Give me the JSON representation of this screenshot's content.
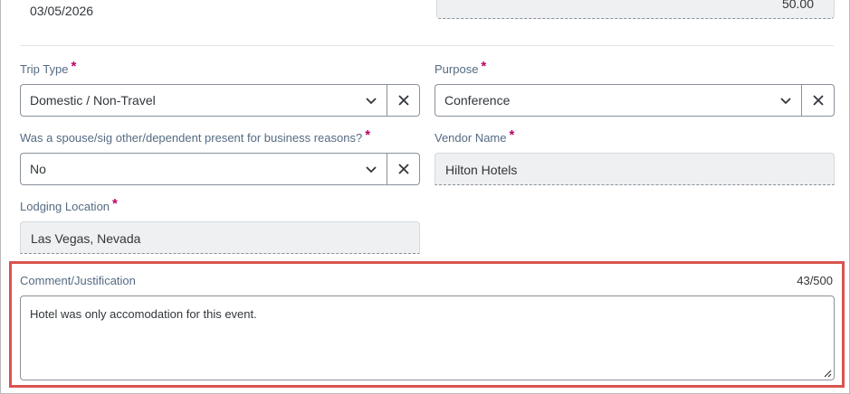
{
  "top": {
    "date_value": "03/05/2026",
    "amount_value": "50.00"
  },
  "trip_type": {
    "label": "Trip Type",
    "value": "Domestic / Non-Travel"
  },
  "purpose": {
    "label": "Purpose",
    "value": "Conference"
  },
  "spouse_present": {
    "label": "Was a spouse/sig other/dependent present for business reasons?",
    "value": "No"
  },
  "vendor_name": {
    "label": "Vendor Name",
    "value": "Hilton Hotels"
  },
  "lodging_location": {
    "label": "Lodging Location",
    "value": "Las Vegas, Nevada"
  },
  "comment": {
    "label": "Comment/Justification",
    "counter": "43/500",
    "value": "Hotel was only accomodation for this event."
  },
  "required_marker": "*",
  "colors": {
    "required": "#bb0066",
    "highlight": "#d9534f",
    "label": "#556b82"
  },
  "icons": {
    "dropdown": "chevron-down-icon",
    "clear": "close-icon",
    "resize": "resize-handle-icon"
  }
}
